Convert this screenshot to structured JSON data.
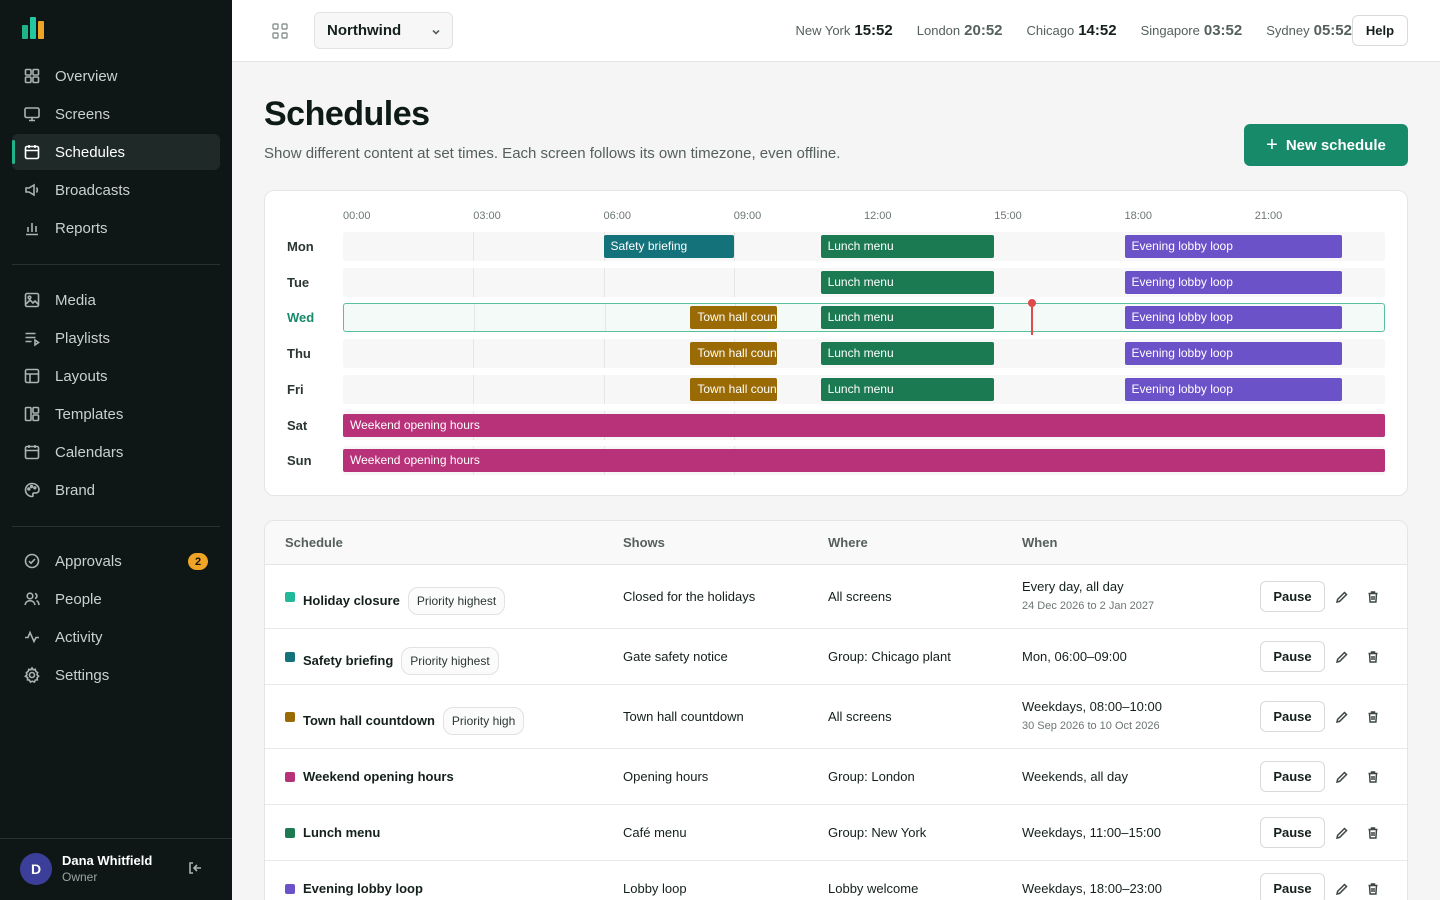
{
  "sidebar": {
    "nav_primary": [
      {
        "label": "Overview",
        "icon": "grid-icon"
      },
      {
        "label": "Screens",
        "icon": "monitor-icon"
      },
      {
        "label": "Schedules",
        "icon": "calendar-icon",
        "active": true
      },
      {
        "label": "Broadcasts",
        "icon": "megaphone-icon"
      },
      {
        "label": "Reports",
        "icon": "bar-chart-icon"
      }
    ],
    "nav_content": [
      {
        "label": "Media",
        "icon": "image-icon"
      },
      {
        "label": "Playlists",
        "icon": "playlist-icon"
      },
      {
        "label": "Layouts",
        "icon": "layout-icon"
      },
      {
        "label": "Templates",
        "icon": "template-icon"
      },
      {
        "label": "Calendars",
        "icon": "calendar-icon"
      },
      {
        "label": "Brand",
        "icon": "palette-icon"
      }
    ],
    "nav_admin": [
      {
        "label": "Approvals",
        "icon": "check-circle-icon",
        "badge": "2"
      },
      {
        "label": "People",
        "icon": "people-icon"
      },
      {
        "label": "Activity",
        "icon": "activity-icon"
      },
      {
        "label": "Settings",
        "icon": "gear-icon"
      }
    ],
    "user": {
      "initial": "D",
      "name": "Dana Whitfield",
      "role": "Owner"
    }
  },
  "topbar": {
    "org": "Northwind",
    "clocks": [
      {
        "city": "New York",
        "time": "15:52"
      },
      {
        "city": "London",
        "time": "20:52"
      },
      {
        "city": "Chicago",
        "time": "14:52"
      },
      {
        "city": "Singapore",
        "time": "03:52"
      },
      {
        "city": "Sydney",
        "time": "05:52"
      }
    ],
    "help_label": "Help"
  },
  "page": {
    "title": "Schedules",
    "subtitle": "Show different content at set times. Each screen follows its own timezone, even offline.",
    "new_button": "New schedule"
  },
  "colors": {
    "accent": "#178a6a",
    "safety": "#13727a",
    "lunch": "#1b7a52",
    "evening": "#6b52c8",
    "townhall": "#9a6a05",
    "weekend": "#b73279",
    "holiday": "#22b89a",
    "now": "#e04a4a"
  },
  "timeline": {
    "hours": [
      "00:00",
      "03:00",
      "06:00",
      "09:00",
      "12:00",
      "15:00",
      "18:00",
      "21:00"
    ],
    "now_hour": 15.87,
    "today": "Wed",
    "days": [
      {
        "day": "Mon",
        "blocks": [
          {
            "label": "Safety briefing",
            "start": 6,
            "end": 9,
            "color": "safety"
          },
          {
            "label": "Lunch menu",
            "start": 11,
            "end": 15,
            "color": "lunch"
          },
          {
            "label": "Evening lobby loop",
            "start": 18,
            "end": 23,
            "color": "evening"
          }
        ]
      },
      {
        "day": "Tue",
        "blocks": [
          {
            "label": "Lunch menu",
            "start": 11,
            "end": 15,
            "color": "lunch"
          },
          {
            "label": "Evening lobby loop",
            "start": 18,
            "end": 23,
            "color": "evening"
          }
        ]
      },
      {
        "day": "Wed",
        "blocks": [
          {
            "label": "Town hall countdown",
            "start": 8,
            "end": 10,
            "color": "townhall"
          },
          {
            "label": "Lunch menu",
            "start": 11,
            "end": 15,
            "color": "lunch"
          },
          {
            "label": "Evening lobby loop",
            "start": 18,
            "end": 23,
            "color": "evening"
          }
        ]
      },
      {
        "day": "Thu",
        "blocks": [
          {
            "label": "Town hall countdown",
            "start": 8,
            "end": 10,
            "color": "townhall"
          },
          {
            "label": "Lunch menu",
            "start": 11,
            "end": 15,
            "color": "lunch"
          },
          {
            "label": "Evening lobby loop",
            "start": 18,
            "end": 23,
            "color": "evening"
          }
        ]
      },
      {
        "day": "Fri",
        "blocks": [
          {
            "label": "Town hall countdown",
            "start": 8,
            "end": 10,
            "color": "townhall"
          },
          {
            "label": "Lunch menu",
            "start": 11,
            "end": 15,
            "color": "lunch"
          },
          {
            "label": "Evening lobby loop",
            "start": 18,
            "end": 23,
            "color": "evening"
          }
        ]
      },
      {
        "day": "Sat",
        "blocks": [
          {
            "label": "Weekend opening hours",
            "start": 0,
            "end": 24,
            "color": "weekend"
          }
        ]
      },
      {
        "day": "Sun",
        "blocks": [
          {
            "label": "Weekend opening hours",
            "start": 0,
            "end": 24,
            "color": "weekend"
          }
        ]
      }
    ]
  },
  "table": {
    "columns": [
      "Schedule",
      "Shows",
      "Where",
      "When"
    ],
    "pause_label": "Pause",
    "rows": [
      {
        "name": "Holiday closure",
        "priority": "Priority highest",
        "color": "holiday",
        "shows": "Closed for the holidays",
        "where": "All screens",
        "when": "Every day, all day",
        "when_sub": "24 Dec 2026 to 2 Jan 2027"
      },
      {
        "name": "Safety briefing",
        "priority": "Priority highest",
        "color": "safety",
        "shows": "Gate safety notice",
        "where": "Group: Chicago plant",
        "when": "Mon, 06:00–09:00",
        "when_sub": ""
      },
      {
        "name": "Town hall countdown",
        "priority": "Priority high",
        "color": "townhall",
        "shows": "Town hall countdown",
        "where": "All screens",
        "when": "Weekdays, 08:00–10:00",
        "when_sub": "30 Sep 2026 to 10 Oct 2026"
      },
      {
        "name": "Weekend opening hours",
        "priority": "",
        "color": "weekend",
        "shows": "Opening hours",
        "where": "Group: London",
        "when": "Weekends, all day",
        "when_sub": ""
      },
      {
        "name": "Lunch menu",
        "priority": "",
        "color": "lunch",
        "shows": "Café menu",
        "where": "Group: New York",
        "when": "Weekdays, 11:00–15:00",
        "when_sub": ""
      },
      {
        "name": "Evening lobby loop",
        "priority": "",
        "color": "evening",
        "shows": "Lobby loop",
        "where": "Lobby welcome",
        "when": "Weekdays, 18:00–23:00",
        "when_sub": ""
      }
    ]
  }
}
